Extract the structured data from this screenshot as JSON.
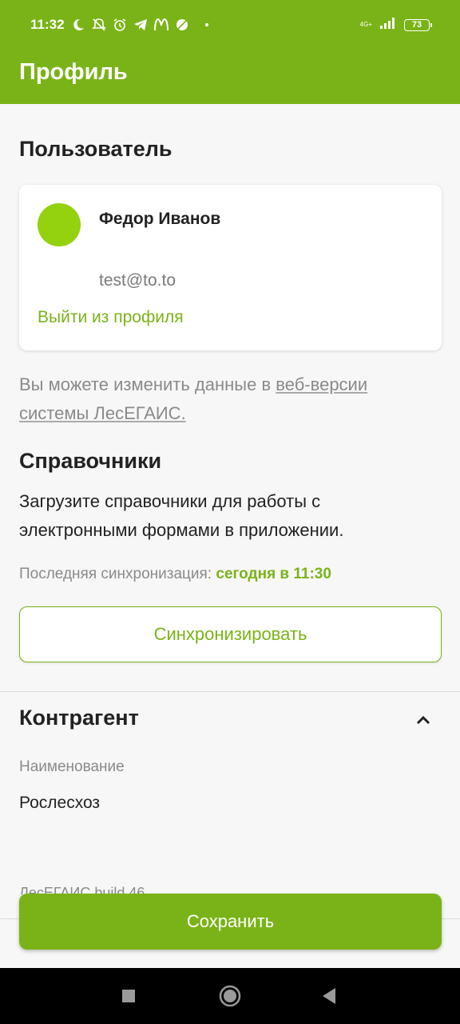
{
  "status_bar": {
    "time": "11:32",
    "network": "4G+",
    "battery": "73",
    "icons": [
      "moon-icon",
      "muted-bell-icon",
      "alarm-icon",
      "telegram-icon",
      "mcdonalds-icon",
      "ball-icon"
    ]
  },
  "app_bar": {
    "title": "Профиль"
  },
  "user_section": {
    "title": "Пользователь",
    "name": "Федор Иванов",
    "email": "test@to.to",
    "logout_label": "Выйти из профиля",
    "hint_prefix": "Вы можете изменить данные в ",
    "hint_link": "веб-версии системы ЛесЕГАИС."
  },
  "references_section": {
    "title": "Справочники",
    "description": "Загрузите справочники для работы с электронными формами в приложении.",
    "last_sync_label": "Последняя синхронизация:",
    "last_sync_value": "сегодня в 11:30",
    "sync_button_label": "Синхронизировать"
  },
  "counterparty_section": {
    "title": "Контрагент",
    "field_label": "Наименование",
    "field_value": "Рослесхоз"
  },
  "build_label": "ЛесЕГАИС build 46",
  "save_button_label": "Сохранить",
  "colors": {
    "accent": "#7ab317",
    "avatar": "#94d10e",
    "muted_text": "#8a8a8a"
  }
}
